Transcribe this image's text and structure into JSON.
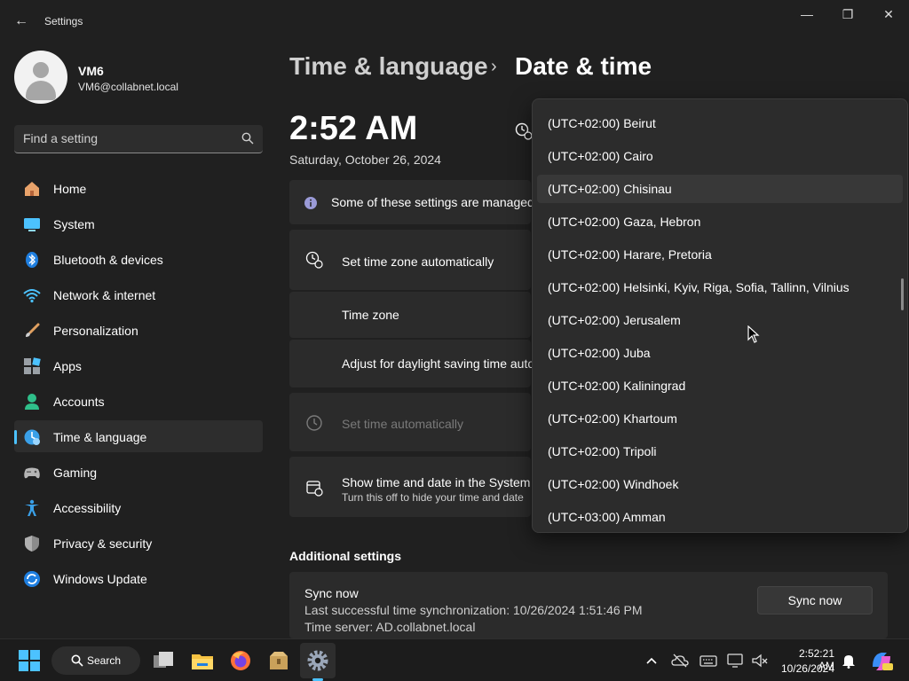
{
  "window": {
    "title": "Settings",
    "minimize_glyph": "—",
    "restore_glyph": "❐",
    "close_glyph": "✕",
    "back_glyph": "←"
  },
  "profile": {
    "name": "VM6",
    "email": "VM6@collabnet.local"
  },
  "search": {
    "placeholder": "Find a setting"
  },
  "sidebar": {
    "items": [
      {
        "label": "Home",
        "icon": "home-icon"
      },
      {
        "label": "System",
        "icon": "system-icon"
      },
      {
        "label": "Bluetooth & devices",
        "icon": "bluetooth-icon"
      },
      {
        "label": "Network & internet",
        "icon": "network-icon"
      },
      {
        "label": "Personalization",
        "icon": "personalization-icon"
      },
      {
        "label": "Apps",
        "icon": "apps-icon"
      },
      {
        "label": "Accounts",
        "icon": "accounts-icon"
      },
      {
        "label": "Time & language",
        "icon": "time-language-icon",
        "selected": true
      },
      {
        "label": "Gaming",
        "icon": "gaming-icon"
      },
      {
        "label": "Accessibility",
        "icon": "accessibility-icon"
      },
      {
        "label": "Privacy & security",
        "icon": "privacy-icon"
      },
      {
        "label": "Windows Update",
        "icon": "windows-update-icon"
      }
    ]
  },
  "header": {
    "parent": "Time & language",
    "separator": "›",
    "current": "Date & time"
  },
  "clock": {
    "time": "2:52 AM",
    "date": "Saturday, October 26, 2024"
  },
  "settings": {
    "managed_notice": "Some of these settings are managed",
    "set_time_zone_auto": "Set time zone automatically",
    "time_zone": "Time zone",
    "daylight_saving": "Adjust for daylight saving time auto",
    "set_time_auto": "Set time automatically",
    "show_in_tray_title": "Show time and date in the System",
    "show_in_tray_sub": "Turn this off to hide your time and date"
  },
  "additional": {
    "title": "Additional settings",
    "sync_title": "Sync now",
    "last_sync": "Last successful time synchronization: 10/26/2024 1:51:46 PM",
    "time_server": "Time server: AD.collabnet.local",
    "sync_button": "Sync now"
  },
  "timezone_dropdown": {
    "options": [
      "(UTC+02:00) Beirut",
      "(UTC+02:00) Cairo",
      "(UTC+02:00) Chisinau",
      "(UTC+02:00) Gaza, Hebron",
      "(UTC+02:00) Harare, Pretoria",
      "(UTC+02:00) Helsinki, Kyiv, Riga, Sofia, Tallinn, Vilnius",
      "(UTC+02:00) Jerusalem",
      "(UTC+02:00) Juba",
      "(UTC+02:00) Kaliningrad",
      "(UTC+02:00) Khartoum",
      "(UTC+02:00) Tripoli",
      "(UTC+02:00) Windhoek",
      "(UTC+03:00) Amman"
    ],
    "hovered": "(UTC+02:00) Chisinau"
  },
  "taskbar": {
    "search_label": "Search",
    "clock_time": "2:52:21 AM",
    "clock_date": "10/26/2024"
  },
  "colors": {
    "accent": "#4cc2ff",
    "background": "#202020",
    "card": "#2b2b2b"
  }
}
